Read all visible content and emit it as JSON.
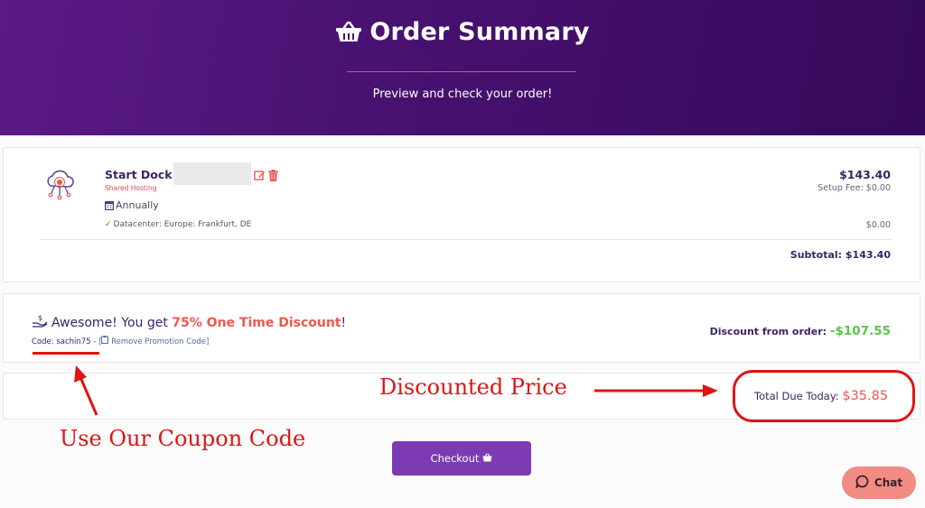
{
  "header": {
    "title": "Order Summary",
    "subtitle": "Preview and check your order!"
  },
  "product": {
    "name": "Start Dock -",
    "category": "Shared Hosting",
    "billing_cycle": "Annually",
    "datacenter": "Datacenter: Europe: Frankfurt, DE",
    "price": "$143.40",
    "setup_fee": "Setup Fee: $0.00",
    "datacenter_price": "$0.00",
    "subtotal": "Subtotal: $143.40",
    "icons": [
      "cloud-hosting-icon",
      "edit-icon",
      "trash-icon",
      "calendar-icon",
      "check-icon"
    ]
  },
  "promo": {
    "prefix": "Awesome! You get ",
    "highlight": "75% One Time Discount",
    "suffix": "!",
    "code_label": "Code: sachin75 - ",
    "remove_label": "Remove Promotion Code]",
    "discount_label": "Discount from order: ",
    "discount_value": "-$107.55"
  },
  "total": {
    "label": "Total Due Today: ",
    "value": "$35.85"
  },
  "checkout": {
    "label": "Checkout"
  },
  "chat": {
    "label": "Chat"
  },
  "annotations": {
    "discounted_price": "Discounted Price",
    "coupon_code": "Use Our Coupon Code"
  },
  "colors": {
    "header_bg": "#47116f",
    "accent_purple": "#7d3bb3",
    "text_dark": "#3d2266",
    "highlight_red": "#f0584b",
    "discount_green": "#5cc24c",
    "annotation_red": "#e01414",
    "chat_bg": "#f28b83"
  }
}
